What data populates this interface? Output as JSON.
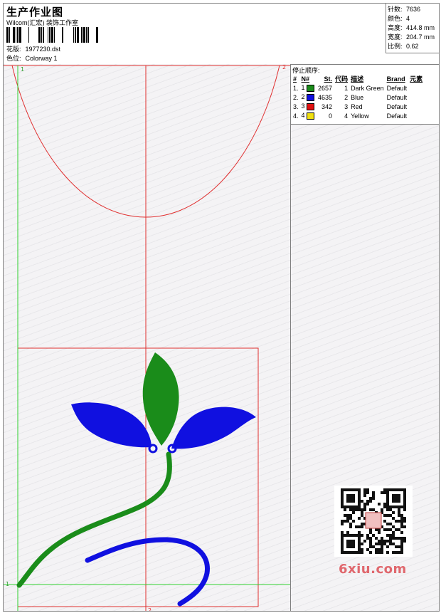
{
  "header": {
    "title": "生产作业图",
    "company": "Wilcom(汇宏) 装饰工作室",
    "design_label": "花版:",
    "design_value": "1977230.dst",
    "colorway_label": "色位:",
    "colorway_value": "Colorway 1"
  },
  "stats": [
    {
      "label": "针数:",
      "value": "7636"
    },
    {
      "label": "颜色:",
      "value": "4"
    },
    {
      "label": "高度:",
      "value": "414.8 mm"
    },
    {
      "label": "宽度:",
      "value": "204.7 mm"
    },
    {
      "label": "比例:",
      "value": "0.62"
    }
  ],
  "legend": {
    "title": "停止顺序:",
    "columns": [
      "#",
      "N#",
      "St.",
      "代码",
      "描述",
      "Brand",
      "元素"
    ],
    "rows": [
      {
        "idx": "1.",
        "n": "1",
        "color": "#1a8c1a",
        "st": "2657",
        "code": "1",
        "desc": "Dark Green",
        "brand": "Default"
      },
      {
        "idx": "2.",
        "n": "2",
        "color": "#1010e0",
        "st": "4635",
        "code": "2",
        "desc": "Blue",
        "brand": "Default"
      },
      {
        "idx": "3.",
        "n": "3",
        "color": "#e01010",
        "st": "342",
        "code": "3",
        "desc": "Red",
        "brand": "Default"
      },
      {
        "idx": "4.",
        "n": "4",
        "color": "#f0e010",
        "st": "0",
        "code": "4",
        "desc": "Yellow",
        "brand": "Default"
      }
    ]
  },
  "markers": {
    "top_left": "1",
    "top_right": "2",
    "bottom_left": "1",
    "bottom_center": "2"
  },
  "watermark": "6xiu.com",
  "colors": {
    "green": "#1a8c1a",
    "blue": "#1010e0",
    "red_guide": "#e03030",
    "green_guide": "#30d030"
  }
}
